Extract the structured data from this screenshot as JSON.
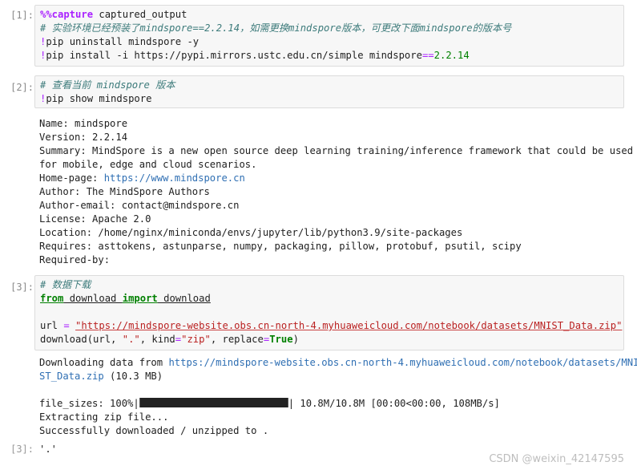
{
  "cells": [
    {
      "prompt": "[1]:",
      "lines": {
        "l1_magic": "%%capture",
        "l1_rest": " captured_output",
        "l2_comment": "# 实验环境已经预装了mindspore==2.2.14，如需更换mindspore版本，可更改下面mindspore的版本号",
        "l3_bang": "!",
        "l3_rest": "pip uninstall mindspore -y",
        "l4_bang": "!",
        "l4_a": "pip install -i https://pypi.mirrors.ustc.edu.cn/simple mindspore",
        "l4_op": "==",
        "l4_ver": "2.2.14"
      }
    },
    {
      "prompt": "[2]:",
      "lines": {
        "l1_comment": "# 查看当前 mindspore 版本",
        "l2_bang": "!",
        "l2_rest": "pip show mindspore"
      },
      "output": {
        "name": "Name: mindspore",
        "version": "Version: 2.2.14",
        "summary1": "Summary: MindSpore is a new open source deep learning training/inference framework that could be used",
        "summary2": "for mobile, edge and cloud scenarios.",
        "homepage_label": "Home-page: ",
        "homepage_url": "https://www.mindspore.cn",
        "author": "Author: The MindSpore Authors",
        "author_email": "Author-email: contact@mindspore.cn",
        "license": "License: Apache 2.0",
        "location": "Location: /home/nginx/miniconda/envs/jupyter/lib/python3.9/site-packages",
        "requires": "Requires: asttokens, astunparse, numpy, packaging, pillow, protobuf, psutil, scipy",
        "required_by": "Required-by:"
      }
    },
    {
      "prompt": "[3]:",
      "lines": {
        "l1_comment": "# 数据下载",
        "l2_from": "from",
        "l2_mod": " download ",
        "l2_import": "import",
        "l2_name": " download",
        "l4_a": "url ",
        "l4_op": "=",
        "l4_sp": " ",
        "l4_str": "\"https://mindspore-website.obs.cn-north-4.myhuaweicloud.com/notebook/datasets/MNIST_Data.zip\"",
        "l5_a": "download(url, ",
        "l5_s1": "\".\"",
        "l5_b": ", kind",
        "l5_op1": "=",
        "l5_s2": "\"zip\"",
        "l5_c": ", replace",
        "l5_op2": "=",
        "l5_true": "True",
        "l5_d": ")"
      },
      "output": {
        "dl_label": "Downloading data from ",
        "dl_url1": "https://mindspore-website.obs.cn-north-4.myhuaweicloud.com/notebook/datasets/MNI",
        "dl_url2": "ST_Data.zip",
        "dl_size": " (10.3 MB)",
        "progress_label": "file_sizes: 100%|",
        "progress_fraction": 1.0,
        "progress_tail": "| 10.8M/10.8M [00:00<00:00, 108MB/s]",
        "extracting": "Extracting zip file...",
        "success": "Successfully downloaded / unzipped to ."
      }
    },
    {
      "prompt": "[3]:",
      "output": {
        "result": "'.'"
      }
    }
  ],
  "watermark": "CSDN @weixin_42147595"
}
